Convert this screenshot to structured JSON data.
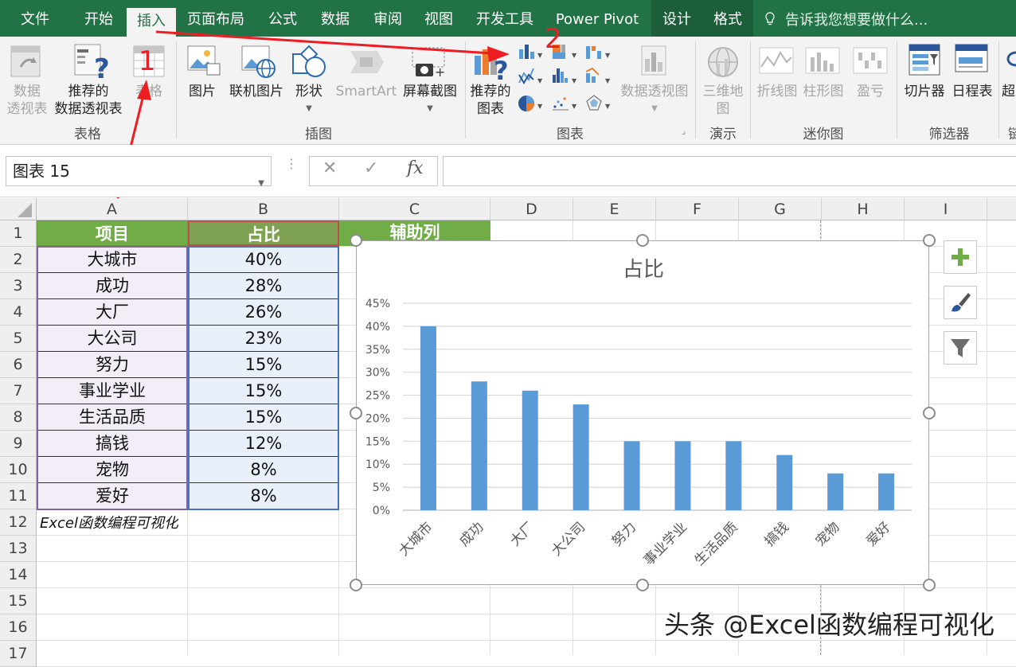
{
  "menu": {
    "tabs": [
      "文件",
      "开始",
      "插入",
      "页面布局",
      "公式",
      "数据",
      "审阅",
      "视图",
      "开发工具",
      "Power Pivot",
      "设计",
      "格式"
    ],
    "active": "插入",
    "tell_me": "告诉我您想要做什么..."
  },
  "ribbon": {
    "table_group": {
      "label": "表格",
      "pivot_line1": "数据",
      "pivot_line2": "透视表",
      "recommended_pivot_line1": "推荐的",
      "recommended_pivot_line2": "数据透视表",
      "table": "表格"
    },
    "illustrations_group": {
      "label": "插图",
      "picture": "图片",
      "online_picture": "联机图片",
      "shapes": "形状",
      "smartart": "SmartArt",
      "screenshot": "屏幕截图"
    },
    "charts_group": {
      "label": "图表",
      "recommended_line1": "推荐的",
      "recommended_line2": "图表",
      "pivot_chart": "数据透视图"
    },
    "tours_group": {
      "label": "演示",
      "map3d_line1": "三维地",
      "map3d_line2": "图"
    },
    "sparklines_group": {
      "label": "迷你图",
      "line": "折线图",
      "column": "柱形图",
      "winloss": "盈亏"
    },
    "filters_group": {
      "label": "筛选器",
      "slicer": "切片器",
      "timeline": "日程表"
    },
    "links_group": {
      "hyperlink": "超",
      "label": "链"
    }
  },
  "annotations": {
    "step1": "1",
    "step2": "2"
  },
  "formula_bar": {
    "name_box": "图表 15",
    "cancel": "✕",
    "enter": "✓",
    "fx": "fx",
    "formula": ""
  },
  "columns": [
    "A",
    "B",
    "C",
    "D",
    "E",
    "F",
    "G",
    "H",
    "I"
  ],
  "rows": [
    "1",
    "2",
    "3",
    "4",
    "5",
    "6",
    "7",
    "8",
    "9",
    "10",
    "11",
    "12",
    "13",
    "14",
    "15",
    "16",
    "17"
  ],
  "table": {
    "headers": [
      "项目",
      "占比",
      "辅助列"
    ],
    "rows": [
      [
        "大城市",
        "40%"
      ],
      [
        "成功",
        "28%"
      ],
      [
        "大厂",
        "26%"
      ],
      [
        "大公司",
        "23%"
      ],
      [
        "努力",
        "15%"
      ],
      [
        "事业学业",
        "15%"
      ],
      [
        "生活品质",
        "15%"
      ],
      [
        "搞钱",
        "12%"
      ],
      [
        "宠物",
        "8%"
      ],
      [
        "爱好",
        "8%"
      ]
    ],
    "note": "Excel函数编程可视化"
  },
  "colors": {
    "header_a": "#70ad47",
    "header_b": "#7fa152",
    "bar": "#5b9bd5",
    "ribbon_green": "#217346"
  },
  "chart_data": {
    "type": "bar",
    "title": "占比",
    "categories": [
      "大城市",
      "成功",
      "大厂",
      "大公司",
      "努力",
      "事业学业",
      "生活品质",
      "搞钱",
      "宠物",
      "爱好"
    ],
    "values": [
      0.4,
      0.28,
      0.26,
      0.23,
      0.15,
      0.15,
      0.15,
      0.12,
      0.08,
      0.08
    ],
    "ylim": [
      0,
      0.45
    ],
    "yticks": [
      "0%",
      "5%",
      "10%",
      "15%",
      "20%",
      "25%",
      "30%",
      "35%",
      "40%",
      "45%"
    ],
    "grid": true,
    "legend": "none"
  },
  "watermark": "头条 @Excel函数编程可视化"
}
